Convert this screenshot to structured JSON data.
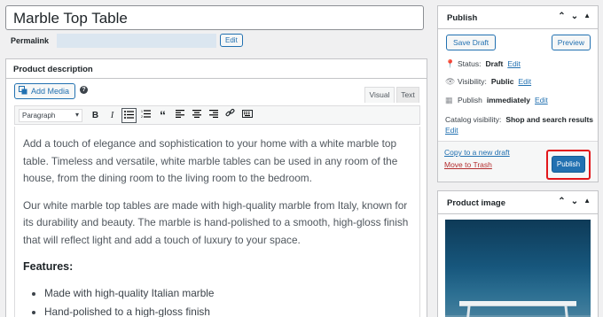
{
  "post": {
    "title": "Marble Top Table",
    "permalink_label": "Permalink",
    "permalink_edit": "Edit"
  },
  "description": {
    "heading": "Product description",
    "add_media": "Add Media",
    "tab_visual": "Visual",
    "tab_text": "Text",
    "format": "Paragraph",
    "paragraphs": [
      "Add a touch of elegance and sophistication to your home with a white marble top table. Timeless and versatile, white marble tables can be used in any room of the house, from the dining room to the living room to the bedroom.",
      "Our white marble top tables are made with high-quality marble from Italy, known for its durability and beauty. The marble is hand-polished to a smooth, high-gloss finish that will reflect light and add a touch of luxury to your space."
    ],
    "features_heading": "Features:",
    "features": [
      "Made with high-quality Italian marble",
      "Hand-polished to a high-gloss finish"
    ],
    "toolbar_icons": [
      "bold-icon",
      "italic-icon",
      "bullet-list-icon",
      "numbered-list-icon",
      "blockquote-icon",
      "align-left-icon",
      "align-center-icon",
      "align-right-icon",
      "link-icon",
      "keyboard-icon"
    ]
  },
  "publish": {
    "title": "Publish",
    "save_draft": "Save Draft",
    "preview": "Preview",
    "status_label": "Status:",
    "status_value": "Draft",
    "visibility_label": "Visibility:",
    "visibility_value": "Public",
    "publish_label": "Publish",
    "publish_value": "immediately",
    "catalog_label": "Catalog visibility:",
    "catalog_value": "Shop and search results",
    "edit": "Edit",
    "copy_draft": "Copy to a new draft",
    "trash": "Move to Trash",
    "publish_button": "Publish",
    "highlight_color": "#e2171b"
  },
  "product_image": {
    "title": "Product image"
  }
}
